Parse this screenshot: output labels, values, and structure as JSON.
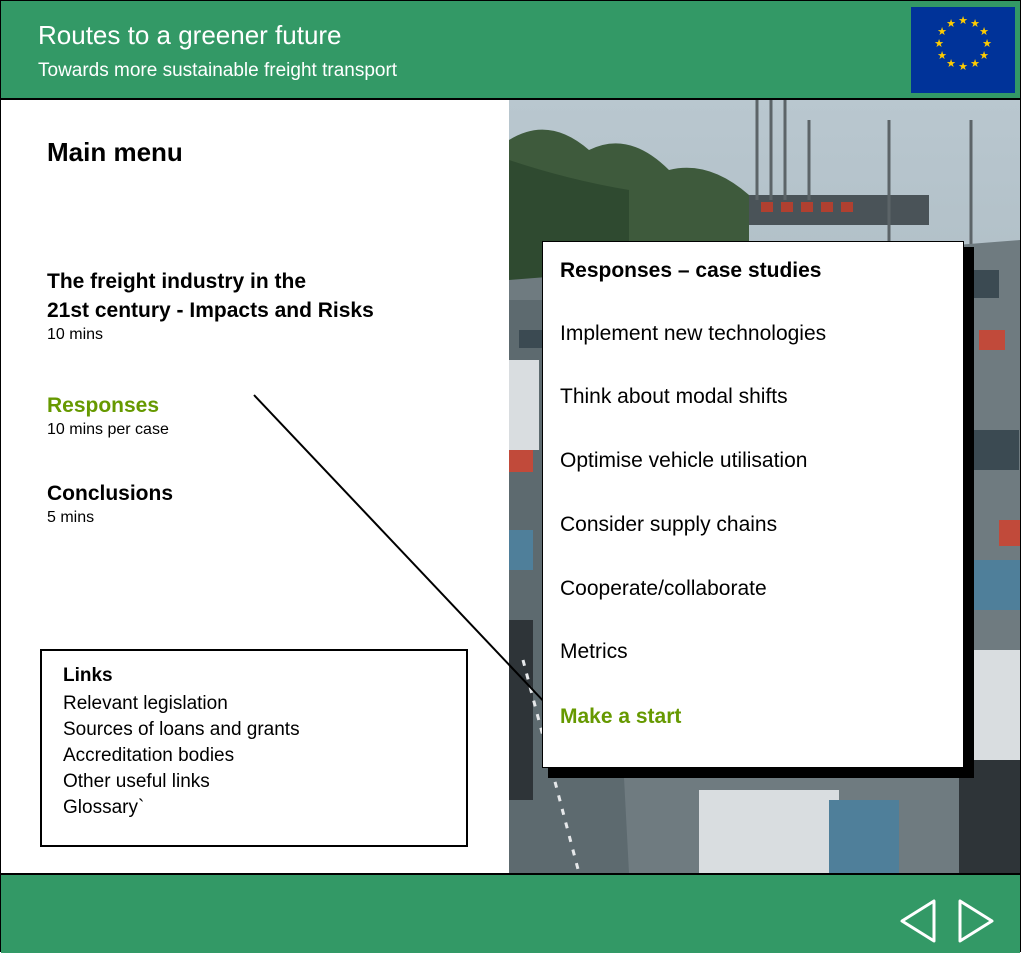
{
  "header": {
    "title": "Routes to a greener future",
    "subtitle": "Towards more sustainable freight transport",
    "brand_color": "#339966",
    "flag_icon": "eu-flag-icon"
  },
  "main": {
    "title": "Main menu",
    "sections": [
      {
        "title_line1": "The freight industry in the",
        "title_line2": "21st century  - Impacts and Risks",
        "duration": "10 mins"
      },
      {
        "title": "Responses",
        "duration": "10 mins per case",
        "color": "#669900"
      },
      {
        "title": "Conclusions",
        "duration": "5 mins"
      }
    ]
  },
  "links": {
    "heading": "Links",
    "items": [
      "Relevant legislation",
      "Sources of loans and grants",
      "Accreditation bodies",
      "Other useful links",
      "Glossary`"
    ]
  },
  "case_studies": {
    "title": "Responses – case studies",
    "items": [
      "Implement new technologies",
      "Think about modal shifts",
      "Optimise vehicle utilisation",
      "Consider supply chains",
      "Cooperate/collaborate",
      "Metrics"
    ],
    "highlight": "Make a start",
    "highlight_color": "#669900"
  },
  "footer": {
    "prev_icon": "triangle-left-icon",
    "next_icon": "triangle-right-icon"
  }
}
